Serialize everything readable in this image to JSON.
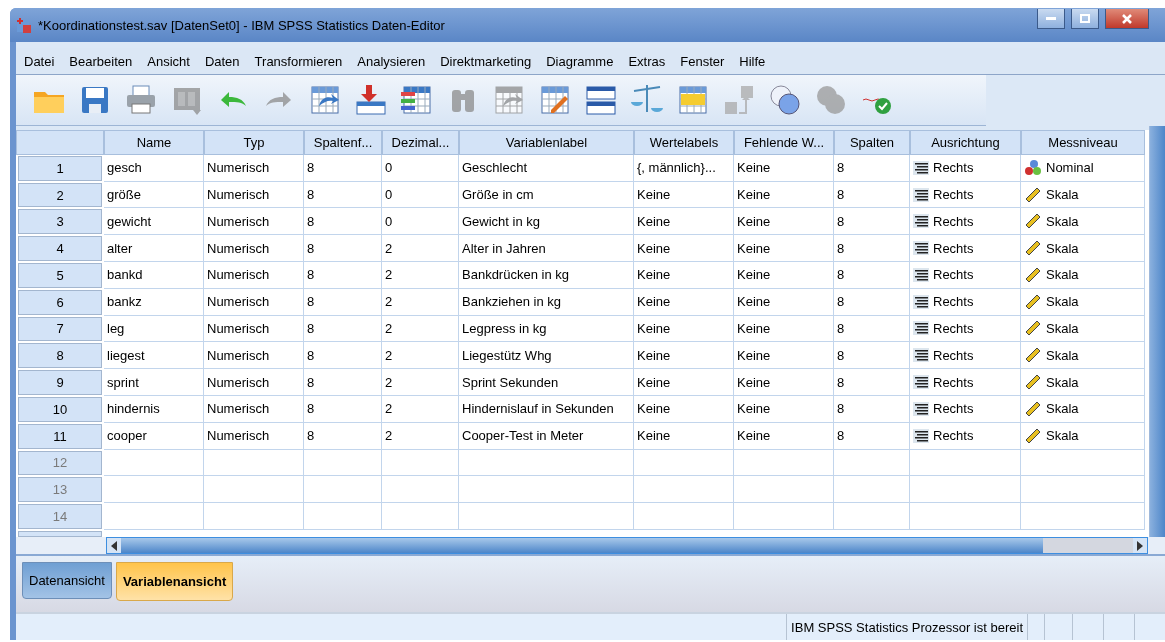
{
  "window": {
    "title": "*Koordinationstest.sav [DatenSet0] - IBM SPSS Statistics Daten-Editor"
  },
  "menu": [
    "Datei",
    "Bearbeiten",
    "Ansicht",
    "Daten",
    "Transformieren",
    "Analysieren",
    "Direktmarketing",
    "Diagramme",
    "Extras",
    "Fenster",
    "Hilfe"
  ],
  "toolbar": [
    {
      "kind": "folder",
      "disabled": false
    },
    {
      "kind": "floppy",
      "disabled": false
    },
    {
      "kind": "printer",
      "disabled": false
    },
    {
      "kind": "dialog",
      "disabled": true
    },
    {
      "kind": "undo",
      "disabled": false
    },
    {
      "kind": "redo",
      "disabled": true
    },
    {
      "kind": "grid-arrow",
      "disabled": false
    },
    {
      "kind": "down-arrow",
      "disabled": false
    },
    {
      "kind": "variable-list",
      "disabled": false
    },
    {
      "kind": "binoculars",
      "disabled": true
    },
    {
      "kind": "grid-arrow",
      "disabled": true
    },
    {
      "kind": "grid-pencil",
      "disabled": false
    },
    {
      "kind": "split-table",
      "disabled": false
    },
    {
      "kind": "balance",
      "disabled": false
    },
    {
      "kind": "yellow-grid",
      "disabled": false
    },
    {
      "kind": "value-labels",
      "disabled": true
    },
    {
      "kind": "circles",
      "disabled": false
    },
    {
      "kind": "circles",
      "disabled": true
    },
    {
      "kind": "spell",
      "disabled": false
    }
  ],
  "table": {
    "columns": [
      "Name",
      "Typ",
      "Spaltenf...",
      "Dezimal...",
      "Variablenlabel",
      "Wertelabels",
      "Fehlende W...",
      "Spalten",
      "Ausrichtung",
      "Messniveau"
    ],
    "rows": [
      {
        "number": "1",
        "cells": [
          "gesch",
          "Numerisch",
          "8",
          "0",
          "Geschlecht",
          "{, männlich}...",
          "Keine",
          "8",
          "Rechts",
          "Nominal"
        ],
        "kind": "nominal"
      },
      {
        "number": "2",
        "cells": [
          "größe",
          "Numerisch",
          "8",
          "0",
          "Größe in cm",
          "Keine",
          "Keine",
          "8",
          "Rechts",
          "Skala"
        ],
        "kind": "scale"
      },
      {
        "number": "3",
        "cells": [
          "gewicht",
          "Numerisch",
          "8",
          "0",
          "Gewicht in kg",
          "Keine",
          "Keine",
          "8",
          "Rechts",
          "Skala"
        ],
        "kind": "scale"
      },
      {
        "number": "4",
        "cells": [
          "alter",
          "Numerisch",
          "8",
          "2",
          "Alter in Jahren",
          "Keine",
          "Keine",
          "8",
          "Rechts",
          "Skala"
        ],
        "kind": "scale"
      },
      {
        "number": "5",
        "cells": [
          "bankd",
          "Numerisch",
          "8",
          "2",
          "Bankdrücken in kg",
          "Keine",
          "Keine",
          "8",
          "Rechts",
          "Skala"
        ],
        "kind": "scale"
      },
      {
        "number": "6",
        "cells": [
          "bankz",
          "Numerisch",
          "8",
          "2",
          "Bankziehen in kg",
          "Keine",
          "Keine",
          "8",
          "Rechts",
          "Skala"
        ],
        "kind": "scale"
      },
      {
        "number": "7",
        "cells": [
          "leg",
          "Numerisch",
          "8",
          "2",
          "Legpress in kg",
          "Keine",
          "Keine",
          "8",
          "Rechts",
          "Skala"
        ],
        "kind": "scale"
      },
      {
        "number": "8",
        "cells": [
          "liegest",
          "Numerisch",
          "8",
          "2",
          "Liegestütz Whg",
          "Keine",
          "Keine",
          "8",
          "Rechts",
          "Skala"
        ],
        "kind": "scale"
      },
      {
        "number": "9",
        "cells": [
          "sprint",
          "Numerisch",
          "8",
          "2",
          "Sprint Sekunden",
          "Keine",
          "Keine",
          "8",
          "Rechts",
          "Skala"
        ],
        "kind": "scale"
      },
      {
        "number": "10",
        "cells": [
          "hindernis",
          "Numerisch",
          "8",
          "2",
          "Hindernislauf in Sekunden",
          "Keine",
          "Keine",
          "8",
          "Rechts",
          "Skala"
        ],
        "kind": "scale"
      },
      {
        "number": "11",
        "cells": [
          "cooper",
          "Numerisch",
          "8",
          "2",
          "Cooper-Test in Meter",
          "Keine",
          "Keine",
          "8",
          "Rechts",
          "Skala"
        ],
        "kind": "scale"
      },
      {
        "number": "12"
      },
      {
        "number": "13"
      },
      {
        "number": "14"
      }
    ]
  },
  "tabs": [
    {
      "label": "Datenansicht",
      "selected": false
    },
    {
      "label": "Variablenansicht",
      "selected": true
    }
  ],
  "status_bar": "IBM SPSS Statistics  Prozessor ist bereit"
}
